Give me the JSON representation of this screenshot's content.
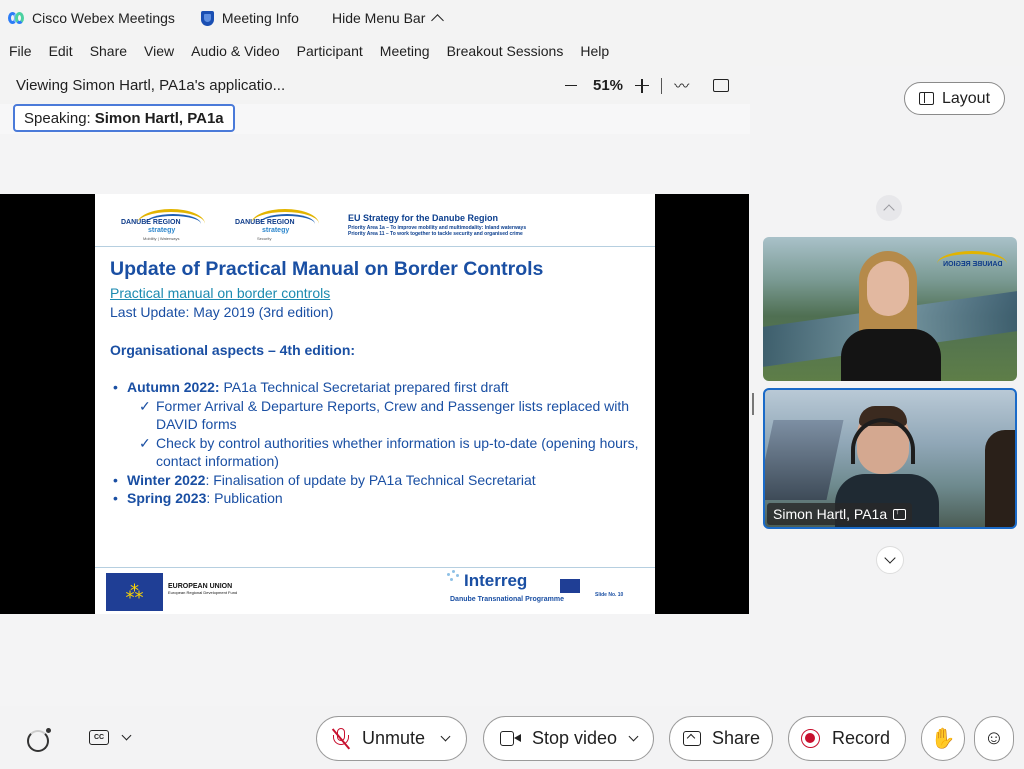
{
  "titlebar": {
    "app_name": "Cisco Webex Meetings",
    "meeting_info": "Meeting Info",
    "hide_menu": "Hide Menu Bar"
  },
  "menu": [
    "File",
    "Edit",
    "Share",
    "View",
    "Audio & Video",
    "Participant",
    "Meeting",
    "Breakout Sessions",
    "Help"
  ],
  "share_header": {
    "viewing": "Viewing Simon Hartl, PA1a's applicatio...",
    "zoom": "51%"
  },
  "speaking": {
    "label": "Speaking:",
    "name": "Simon Hartl, PA1a"
  },
  "layout_button": "Layout",
  "slide": {
    "logo1": {
      "line1": "DANUBE REGION",
      "line2": "strategy",
      "line3": "Mobility | Waterways"
    },
    "logo2": {
      "line1": "DANUBE REGION",
      "line2": "strategy",
      "line3": "Security"
    },
    "eus_title": "EU Strategy for the Danube Region",
    "eus_pa1": "Priority Area 1a – To improve mobility and multimodality: Inland waterways",
    "eus_pa2": "Priority Area 11 – To work together to tackle security and organised crime",
    "title": "Update of Practical Manual on Border Controls",
    "link": "Practical manual on border controls",
    "last_update": "Last Update: May 2019 (3rd edition)",
    "org_heading": "Organisational aspects – 4th edition:",
    "b1_bold": "Autumn 2022:",
    "b1_text": " PA1a Technical Secretariat prepared first draft",
    "s1": "Former Arrival & Departure Reports, Crew and Passenger lists replaced with DAVID forms",
    "s2": "Check by control authorities whether information is up-to-date (opening hours, contact information)",
    "b2_bold": "Winter 2022",
    "b2_text": ": Finalisation of update by PA1a Technical Secretariat",
    "b3_bold": "Spring 2023",
    "b3_text": ": Publication",
    "eu": "EUROPEAN UNION",
    "eu_sub": "European Regional Development Fund",
    "interreg": "Interreg",
    "dtp": "Danube Transnational Programme",
    "slide_no": "Slide No. 10"
  },
  "participants": {
    "tile1_logo": "DANUBE REGION",
    "tile2_name": "Simon Hartl, PA1a"
  },
  "controls": {
    "unmute": "Unmute",
    "stop_video": "Stop video",
    "share": "Share",
    "record": "Record",
    "cc": "CC"
  }
}
